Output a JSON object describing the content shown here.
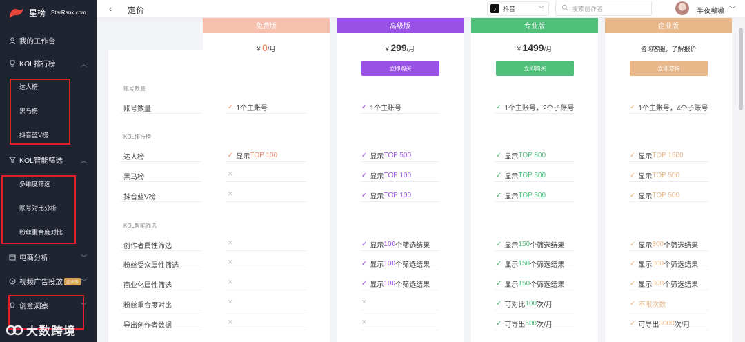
{
  "brand": {
    "name": "星榜",
    "sub": "StarRank.com"
  },
  "sidebar": {
    "nav": [
      {
        "label": "我的工作台",
        "icon": "user-icon"
      },
      {
        "label": "KOL排行榜",
        "icon": "trophy-icon"
      },
      {
        "label": "KOL智能筛选",
        "icon": "filter-icon"
      },
      {
        "label": "电商分析",
        "icon": "shop-icon"
      },
      {
        "label": "视频广告投放",
        "icon": "video-icon",
        "badge": "企业版"
      },
      {
        "label": "创意洞察",
        "icon": "bulb-icon"
      }
    ],
    "rank_sub": [
      "达人榜",
      "黑马榜",
      "抖音蓝V榜"
    ],
    "filter_sub": [
      "多维度筛选",
      "账号对比分析",
      "粉丝重合度对比"
    ],
    "watermark": "大数跨境"
  },
  "topbar": {
    "back": "‹",
    "title": "定价",
    "platform": "抖音",
    "search_placeholder": "搜索创作者",
    "username": "半夜嗷嗷"
  },
  "colors": {
    "free": "#f7c0ae",
    "advanced": "#9a52e6",
    "pro": "#4fbf7a",
    "enterprise": "#e8b88a",
    "x_mark": "#b8bcc4",
    "highlight_free": "#f08a6c"
  },
  "plans": [
    {
      "name": "免费版",
      "currency": "¥",
      "price": "0",
      "unit": "/月",
      "button": ""
    },
    {
      "name": "高级版",
      "currency": "¥",
      "price": "299",
      "unit": "/月",
      "button": "立即购买"
    },
    {
      "name": "专业版",
      "currency": "¥",
      "price": "1499",
      "unit": "/月",
      "button": "立即购买"
    },
    {
      "name": "企业版",
      "contact": "咨询客服，了解报价",
      "button": "立即咨询"
    }
  ],
  "sections": {
    "account": "账号数量",
    "kol_rank": "KOL排行榜",
    "kol_filter": "KOL智能筛选"
  },
  "features": [
    {
      "label": "账号数量",
      "cells": [
        {
          "pre": "1个主账号",
          "hl": "",
          "post": ""
        },
        {
          "pre": "1个主账号",
          "hl": "",
          "post": ""
        },
        {
          "pre": "1个主账号，2个子账号",
          "hl": "",
          "post": ""
        },
        {
          "pre": "1个主账号，4个子账号",
          "hl": "",
          "post": ""
        }
      ]
    },
    {
      "label": "达人榜",
      "cells": [
        {
          "pre": "显示",
          "hl": "TOP 100",
          "post": ""
        },
        {
          "pre": "显示",
          "hl": "TOP 500",
          "post": ""
        },
        {
          "pre": "显示",
          "hl": "TOP 800",
          "post": ""
        },
        {
          "pre": "显示",
          "hl": "TOP 1500",
          "post": ""
        }
      ]
    },
    {
      "label": "黑马榜",
      "cells": [
        {
          "x": true
        },
        {
          "pre": "显示",
          "hl": "TOP 100",
          "post": ""
        },
        {
          "pre": "显示",
          "hl": "TOP 300",
          "post": ""
        },
        {
          "pre": "显示",
          "hl": "TOP 500",
          "post": ""
        }
      ]
    },
    {
      "label": "抖音蓝V榜",
      "cells": [
        {
          "x": true
        },
        {
          "pre": "显示",
          "hl": "TOP 100",
          "post": ""
        },
        {
          "pre": "显示",
          "hl": "TOP 300",
          "post": ""
        },
        {
          "pre": "显示",
          "hl": "TOP 500",
          "post": ""
        }
      ]
    },
    {
      "label": "创作者属性筛选",
      "cells": [
        {
          "x": true
        },
        {
          "pre": "显示",
          "hl": "100",
          "post": "个筛选结果"
        },
        {
          "pre": "显示",
          "hl": "150",
          "post": "个筛选结果"
        },
        {
          "pre": "显示",
          "hl": "300",
          "post": "个筛选结果"
        }
      ]
    },
    {
      "label": "粉丝受众属性筛选",
      "cells": [
        {
          "x": true
        },
        {
          "pre": "显示",
          "hl": "100",
          "post": "个筛选结果"
        },
        {
          "pre": "显示",
          "hl": "150",
          "post": "个筛选结果"
        },
        {
          "pre": "显示",
          "hl": "300",
          "post": "个筛选结果"
        }
      ]
    },
    {
      "label": "商业化属性筛选",
      "cells": [
        {
          "x": true
        },
        {
          "pre": "显示",
          "hl": "100",
          "post": "个筛选结果"
        },
        {
          "pre": "显示",
          "hl": "150",
          "post": "个筛选结果"
        },
        {
          "pre": "显示",
          "hl": "300",
          "post": "个筛选结果"
        }
      ]
    },
    {
      "label": "粉丝重合度对比",
      "cells": [
        {
          "x": true
        },
        {
          "x": true
        },
        {
          "pre": "可对比 ",
          "hl": "100",
          "post": "次/月"
        },
        {
          "pre": "",
          "hl": "不限次数",
          "post": ""
        }
      ]
    },
    {
      "label": "导出创作者数据",
      "cells": [
        {
          "x": true
        },
        {
          "x": true
        },
        {
          "pre": "可导出 ",
          "hl": "500",
          "post": "次/月"
        },
        {
          "pre": "可导出 ",
          "hl": "3000",
          "post": "次/月"
        }
      ]
    }
  ]
}
